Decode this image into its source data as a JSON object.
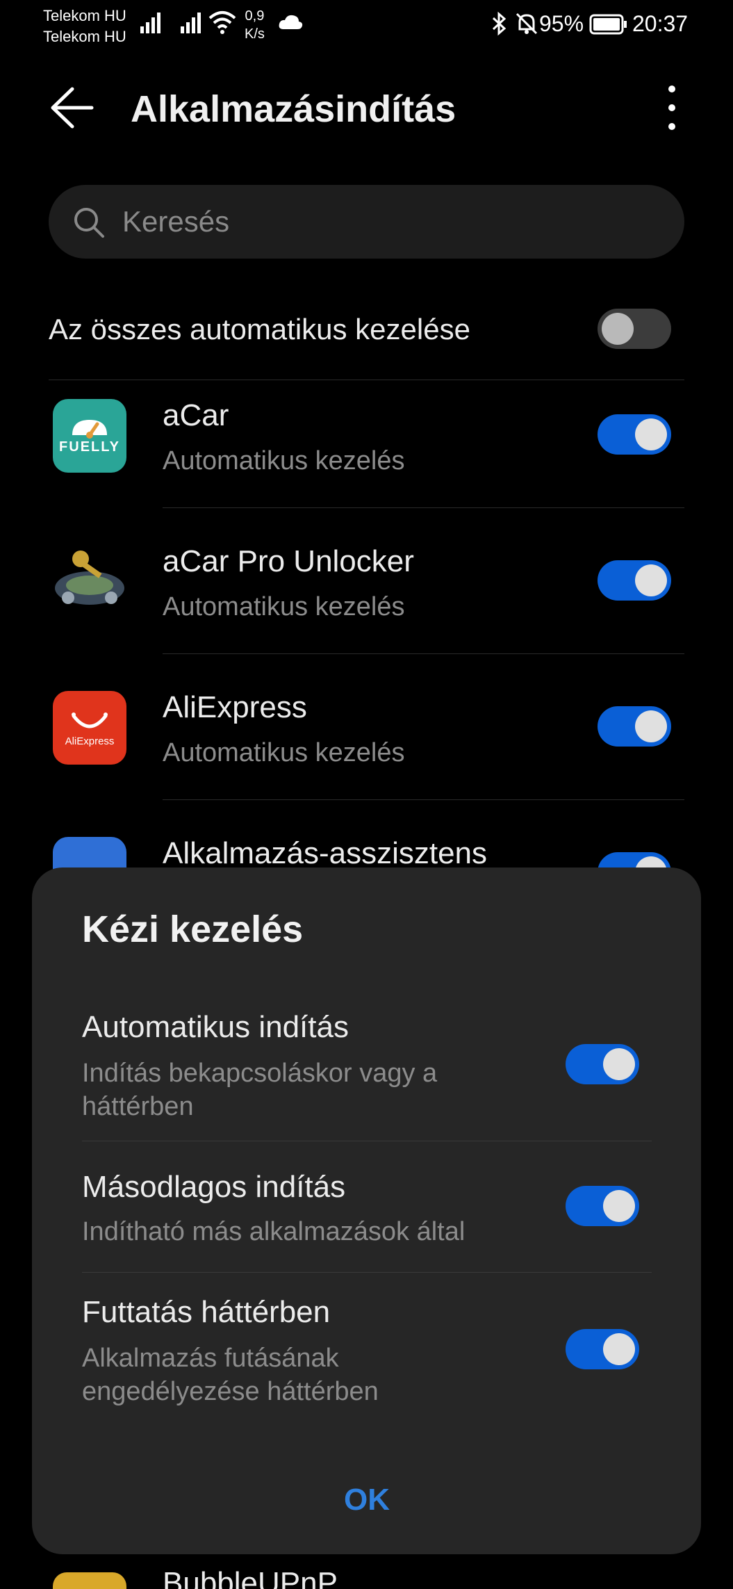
{
  "status_bar": {
    "carrier_1": "Telekom HU",
    "carrier_2": "Telekom HU",
    "speed_value": "0,9",
    "speed_unit": "K/s",
    "battery": "95%",
    "time": "20:37",
    "icons": [
      "signal-icon",
      "signal-icon",
      "wifi-icon",
      "cloud-icon",
      "bluetooth-icon",
      "bell-off-icon",
      "battery-icon"
    ]
  },
  "header": {
    "title": "Alkalmazásindítás",
    "back_icon": "arrow-left-icon",
    "menu_icon": "more-vertical-icon"
  },
  "search": {
    "placeholder": "Keresés"
  },
  "manage_all": {
    "label": "Az összes automatikus kezelése",
    "enabled": false
  },
  "apps": [
    {
      "name": "aCar",
      "status": "Automatikus kezelés",
      "enabled": true,
      "icon": "fuelly-icon",
      "icon_text": "FUELLY"
    },
    {
      "name": "aCar Pro Unlocker",
      "status": "Automatikus kezelés",
      "enabled": true,
      "icon": "car-key-icon"
    },
    {
      "name": "AliExpress",
      "status": "Automatikus kezelés",
      "enabled": true,
      "icon": "aliexpress-icon",
      "icon_text": "AliExpress"
    },
    {
      "name": "Alkalmazás-asszisztens",
      "status": "",
      "enabled": true,
      "icon": "app-assistant-icon"
    }
  ],
  "dialog": {
    "title": "Kézi kezelés",
    "options": [
      {
        "title": "Automatikus indítás",
        "desc": "Indítás bekapcsoláskor vagy a háttérben",
        "enabled": true
      },
      {
        "title": "Másodlagos indítás",
        "desc": "Indítható más alkalmazások által",
        "enabled": true
      },
      {
        "title": "Futtatás háttérben",
        "desc": "Alkalmazás futásának engedélyezése háttérben",
        "enabled": true
      }
    ],
    "ok_label": "OK"
  },
  "bottom_partial_app": {
    "name": "BubbleUPnP"
  },
  "colors": {
    "toggle_on": "#0a5fd6",
    "toggle_off": "#3c3c3c",
    "accent_text": "#2f80de",
    "dialog_bg": "#262626"
  }
}
